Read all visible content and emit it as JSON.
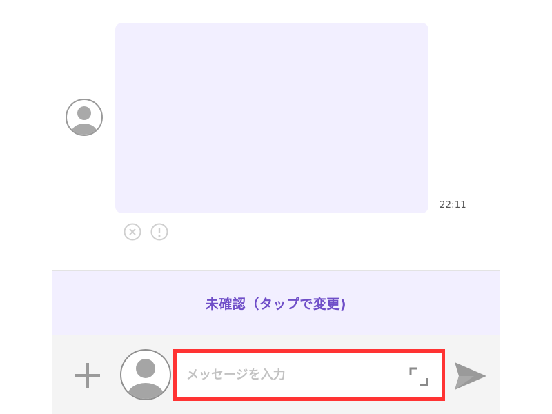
{
  "message": {
    "timestamp": "22:11",
    "status_icons": [
      "cancel-circle-icon",
      "warning-circle-icon"
    ]
  },
  "status_bar": {
    "label": "未確認（タップで変更)"
  },
  "composer": {
    "placeholder": "メッセージを入力",
    "value": "",
    "add_icon": "plus-icon",
    "expand_icon": "expand-icon",
    "send_icon": "send-icon"
  },
  "colors": {
    "bubble": "#f2efff",
    "accent": "#6f4ec8",
    "highlight": "#ff3333",
    "icon_gray": "#9a9a9a"
  }
}
